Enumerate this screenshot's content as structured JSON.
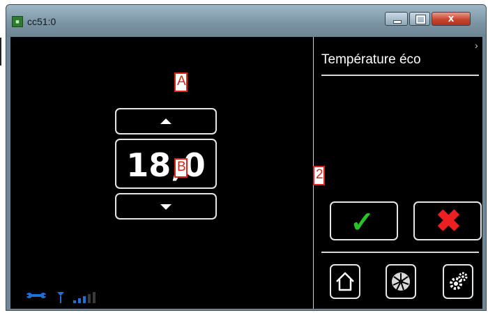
{
  "window": {
    "title": "cc51:0",
    "close_glyph": "x"
  },
  "panel": {
    "title": "Température éco"
  },
  "temperature": {
    "value": "18,0"
  },
  "annotations": {
    "a": "A",
    "b": "B",
    "two": "2"
  },
  "actions": {
    "confirm_icon": "check-icon",
    "cancel_icon": "cross-icon"
  },
  "nav": {
    "icons": [
      "home-icon",
      "fan-icon",
      "settings-icon"
    ]
  },
  "status": {
    "icons": [
      "wrench-icon",
      "antenna-icon",
      "signal-bars-icon"
    ]
  },
  "colors": {
    "screen": "#000000",
    "accent_ok": "#27c427",
    "accent_cancel": "#ec2020",
    "status_blue": "#1e6fd8",
    "annotation": "#e0231a"
  }
}
